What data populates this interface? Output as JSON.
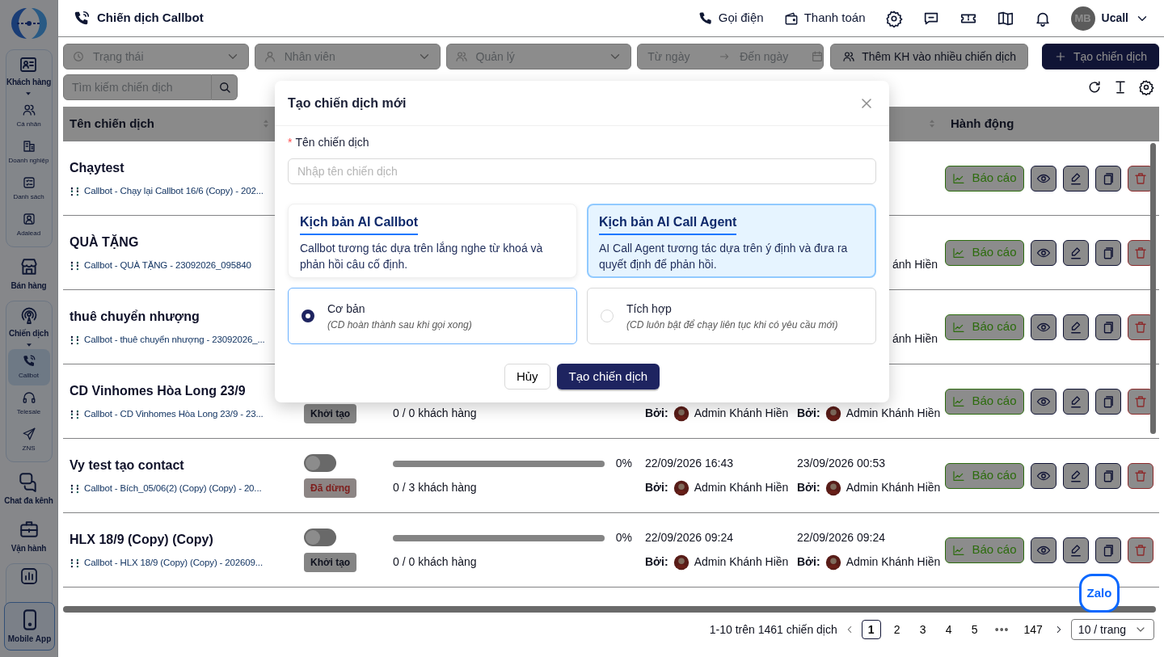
{
  "sidebar": {
    "items": [
      {
        "kind": "group",
        "label": "Khách hàng",
        "expanded": true,
        "children": [
          {
            "label": "Cá nhân",
            "selected": false
          },
          {
            "label": "Doanh nghiệp",
            "selected": false
          },
          {
            "label": "Danh sách",
            "selected": false
          },
          {
            "label": "Adalead",
            "selected": false
          }
        ]
      },
      {
        "kind": "item",
        "label": "Bán hàng"
      },
      {
        "kind": "group",
        "label": "Chiến dịch",
        "expanded": true,
        "children": [
          {
            "label": "Callbot",
            "selected": true
          },
          {
            "label": "Telesale",
            "selected": false
          },
          {
            "label": "ZNS",
            "selected": false
          }
        ]
      },
      {
        "kind": "item",
        "label": "Chat đa kênh"
      },
      {
        "kind": "item",
        "label": "Vận hành"
      },
      {
        "kind": "stub"
      }
    ],
    "mobile_app": "Mobile App"
  },
  "topbar": {
    "title": "Chiến dịch Callbot",
    "links": [
      {
        "label": "Gọi điện"
      },
      {
        "label": "Thanh toán"
      }
    ],
    "user": {
      "initials": "MB",
      "name": "Ucall"
    }
  },
  "filters": [
    {
      "placeholder": "Trạng thái"
    },
    {
      "placeholder": "Nhân viên"
    },
    {
      "placeholder": "Quản lý"
    }
  ],
  "date_range": {
    "from_placeholder": "Từ ngày",
    "to_placeholder": "Đến ngày"
  },
  "bulk_add_button": "Thêm KH vào nhiều chiến dịch",
  "create_button": "Tạo chiến dịch",
  "search": {
    "placeholder": "Tìm kiếm chiến dịch"
  },
  "table": {
    "columns": [
      {
        "label": "Tên chiến dịch",
        "sortable": true
      },
      {
        "sortable": true
      },
      {
        "label": "Hành động",
        "sortable": false
      }
    ],
    "rows": [
      {
        "name": "Chạytest",
        "script": "Callbot - Chạy lại Callbot 16/6 (Copy) - 202...",
        "report": "Báo cáo"
      },
      {
        "name": "QUÀ TẶNG",
        "script": "Callbot - QUÀ TẶNG - 23092026_095840",
        "updated": {
          "by": "ánh Hiền"
        },
        "report": "Báo cáo"
      },
      {
        "name": "thuê chuyển nhượng",
        "script": "Callbot - thuê chuyển nhượng - 23092026_...",
        "updated": {
          "by": "ánh Hiền"
        },
        "report": "Báo cáo"
      },
      {
        "name": "CD Vinhomes Hòa Long 23/9",
        "script": "Callbot - CD Vinhomes Hòa Long 23/9 - 23...",
        "status": "Khởi tạo",
        "kind": "initialized",
        "customers": "0 / 0 khách hàng",
        "created": {
          "by_label": "Bởi:",
          "by": "Admin Khánh Hiền"
        },
        "updated": {
          "by_label": "Bởi:",
          "by": "Admin Khánh Hiền"
        },
        "report": "Báo cáo"
      },
      {
        "name": "Vy test tạo contact",
        "script": "Callbot - Bích_05/06(2) (Copy) (Copy) - 20...",
        "on": false,
        "status": "Đã dừng",
        "kind": "stopped",
        "level": 0,
        "percent": "0%",
        "customers": "0 / 3 khách hàng",
        "created": {
          "time": "22/09/2026 16:43",
          "by_label": "Bởi:",
          "by": "Admin Khánh Hiền"
        },
        "updated": {
          "time": "23/09/2026 00:53",
          "by_label": "Bởi:",
          "by": "Admin Khánh Hiền"
        },
        "report": "Báo cáo"
      },
      {
        "name": "HLX 18/9 (Copy) (Copy)",
        "script": "Callbot - HLX 18/9 (Copy) (Copy) - 202609...",
        "on": false,
        "status": "Khởi tạo",
        "kind": "initialized",
        "level": 0,
        "percent": "0%",
        "customers": "0 / 0 khách hàng",
        "created": {
          "time": "22/09/2026 09:24",
          "by_label": "Bởi:",
          "by": "Admin Khánh Hiền"
        },
        "updated": {
          "time": "22/09/2026 09:24",
          "by_label": "Bởi:",
          "by": "Admin Khánh Hiền"
        },
        "report": "Báo cáo"
      }
    ]
  },
  "pagination": {
    "summary": "1-10 trên 1461 chiến dịch",
    "pages": [
      {
        "kind": "page",
        "label": "1",
        "selected": true
      },
      {
        "kind": "page",
        "label": "2",
        "selected": false
      },
      {
        "kind": "page",
        "label": "3",
        "selected": false
      },
      {
        "kind": "page",
        "label": "4",
        "selected": false
      },
      {
        "kind": "page",
        "label": "5",
        "selected": false
      },
      {
        "kind": "ellipsis",
        "label": "•••",
        "selected": false
      },
      {
        "kind": "page",
        "label": "147",
        "selected": false
      }
    ],
    "page_size": "10 / trang"
  },
  "zalo": "Zalo",
  "modal": {
    "title": "Tạo chiến dịch mới",
    "field": {
      "required_mark": "*",
      "label": "Tên chiến dịch",
      "placeholder": "Nhập tên chiến dịch"
    },
    "scripts": [
      {
        "title": "Kịch bản AI Callbot",
        "description": "Callbot tương tác dựa trên lắng nghe từ khoá và phản hồi câu cố định.",
        "selected": false
      },
      {
        "title": "Kịch bản AI Call Agent",
        "description": "AI Call Agent tương tác dựa trên ý định và đưa ra quyết định để phản hồi.",
        "selected": true
      }
    ],
    "modes": [
      {
        "label": "Cơ bản",
        "hint": "(CD hoàn thành sau khi gọi xong)",
        "selected": true
      },
      {
        "label": "Tích hợp",
        "hint": "(CD luôn bật để chạy liên tục khi có yêu cầu mới)",
        "selected": false
      }
    ],
    "cancel": "Hủy",
    "submit": "Tạo chiến dịch"
  }
}
